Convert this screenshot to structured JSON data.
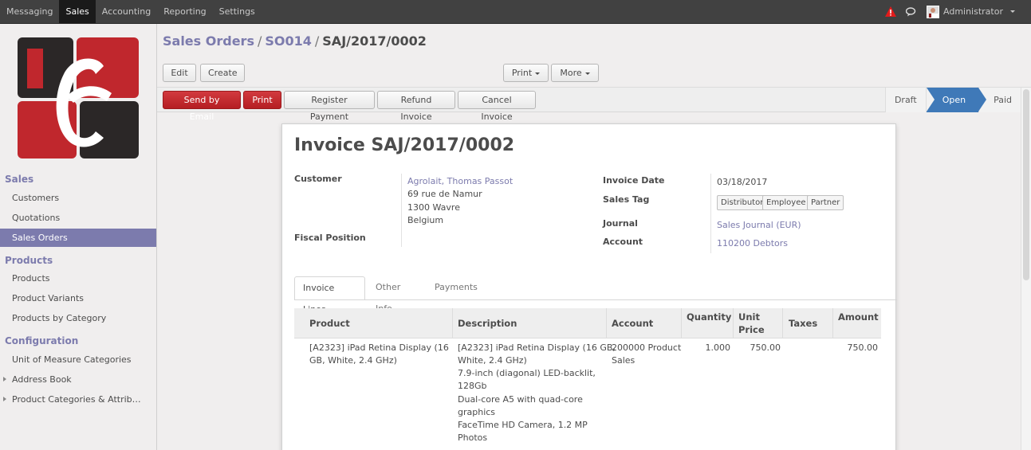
{
  "topbar": {
    "menu": [
      "Messaging",
      "Sales",
      "Accounting",
      "Reporting",
      "Settings"
    ],
    "active_menu": "Sales",
    "user_name": "Administrator",
    "colors": {
      "bar": "#414141",
      "active": "#1a1a1a",
      "warning": "#e31b1b"
    }
  },
  "sidebar": {
    "sections": [
      {
        "title": "Sales",
        "items": [
          "Customers",
          "Quotations",
          "Sales Orders"
        ]
      },
      {
        "title": "Products",
        "items": [
          "Products",
          "Product Variants",
          "Products by Category"
        ]
      },
      {
        "title": "Configuration",
        "items": [
          "Unit of Measure Categories",
          "Address Book",
          "Product Categories & Attrib…"
        ]
      }
    ],
    "active_item": "Sales Orders",
    "accent": "#7c7bad"
  },
  "breadcrumb": {
    "part1": "Sales Orders",
    "part2": "SO014",
    "current": "SAJ/2017/0002",
    "separator": "/"
  },
  "buttons": {
    "edit": "Edit",
    "create": "Create",
    "print_menu": "Print",
    "more_menu": "More"
  },
  "actions": {
    "send_email": "Send by Email",
    "print": "Print",
    "register_payment": "Register Payment",
    "refund": "Refund Invoice",
    "cancel": "Cancel Invoice"
  },
  "states": {
    "draft": "Draft",
    "open": "Open",
    "paid": "Paid",
    "current": "Open"
  },
  "invoice": {
    "title": "Invoice SAJ/2017/0002",
    "customer_label": "Customer",
    "customer_name": "Agrolait, Thomas Passot",
    "address1": "69 rue de Namur",
    "address2": "1300 Wavre",
    "country": "Belgium",
    "fiscal_position_label": "Fiscal Position",
    "invoice_date_label": "Invoice Date",
    "invoice_date": "03/18/2017",
    "sales_tag_label": "Sales Tag",
    "tags": [
      "Distributor",
      "Employee",
      "Partner"
    ],
    "journal_label": "Journal",
    "journal": "Sales Journal (EUR)",
    "account_label": "Account",
    "account": "110200 Debtors"
  },
  "tabs": [
    "Invoice Lines",
    "Other Info",
    "Payments"
  ],
  "table": {
    "headers": {
      "product": "Product",
      "description": "Description",
      "account": "Account",
      "quantity": "Quantity",
      "unit_price_1": "Unit",
      "unit_price_2": "Price",
      "taxes": "Taxes",
      "amount": "Amount"
    },
    "row": {
      "product_1": "[A2323] iPad Retina Display (16",
      "product_2": "GB, White, 2.4 GHz)",
      "description": [
        "[A2323] iPad Retina Display (16 GB,",
        "White, 2.4 GHz)",
        "7.9-inch (diagonal) LED-backlit,",
        "128Gb",
        "Dual-core A5 with quad-core",
        "graphics",
        "FaceTime HD Camera, 1.2 MP",
        "Photos"
      ],
      "account_1": "200000 Product",
      "account_2": "Sales",
      "quantity": "1.000",
      "unit_price": "750.00",
      "amount": "750.00"
    }
  }
}
